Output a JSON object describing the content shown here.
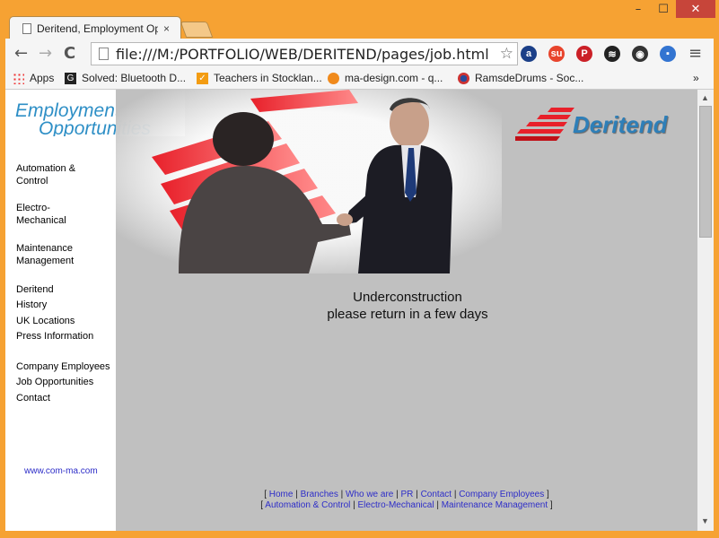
{
  "tab": {
    "title": "Deritend, Employment Op",
    "close": "×"
  },
  "window": {
    "minimize": "–",
    "maximize": "☐",
    "close": "✕"
  },
  "toolbar": {
    "back": "←",
    "forward": "→",
    "reload": "C",
    "url": "file:///M:/PORTFOLIO/WEB/DERITEND/pages/job.html",
    "star": "☆",
    "menu": "≡"
  },
  "extensions": [
    {
      "name": "amazon-icon",
      "label": "a",
      "color": "#1b3f88"
    },
    {
      "name": "stumbleupon-icon",
      "label": "su",
      "color": "#e8442c"
    },
    {
      "name": "pinterest-icon",
      "label": "P",
      "color": "#cb2027"
    },
    {
      "name": "layers-icon",
      "label": "≋",
      "color": "#222222"
    },
    {
      "name": "color-picker-icon",
      "label": "◉",
      "color": "#333333"
    },
    {
      "name": "delicious-icon",
      "label": "▪",
      "color": "#3274d1"
    }
  ],
  "bookmarks": [
    {
      "label": "Apps",
      "icon": "apps-icon"
    },
    {
      "label": "Solved: Bluetooth D...",
      "icon": "g-icon"
    },
    {
      "label": "Teachers in Stocklan...",
      "icon": "check-icon"
    },
    {
      "label": "ma-design.com - q...",
      "icon": "peach-icon"
    },
    {
      "label": "RamsdeDrums - Soc...",
      "icon": "drums-icon"
    }
  ],
  "bookmarks_more": "»",
  "header": {
    "line1": "Employment",
    "line2": "Opportunities",
    "logo": "Deritend"
  },
  "menu": [
    {
      "label": "Automation &",
      "top": 0
    },
    {
      "label": "Control",
      "top": 0
    },
    {
      "label": "Electro-",
      "top": 0
    },
    {
      "label": "Mechanical",
      "top": 0
    },
    {
      "label": "Maintenance",
      "top": 0
    },
    {
      "label": "Management",
      "top": 0
    },
    {
      "label": "Deritend",
      "top": 0
    },
    {
      "label": "History",
      "top": 0
    },
    {
      "label": "UK Locations",
      "top": 0
    },
    {
      "label": "Press Information",
      "top": 0
    },
    {
      "label": "Company Employees",
      "top": 0
    },
    {
      "label": "Job Opportunities",
      "top": 0
    },
    {
      "label": "Contact",
      "top": 0
    }
  ],
  "weblink": "www.com-ma.com",
  "message": {
    "line1": "Underconstruction",
    "line2": "please return in a few days"
  },
  "footer1": [
    "Home",
    "Branches",
    "Who we are",
    "PR",
    "Contact",
    "Company Employees"
  ],
  "footer2": [
    "Automation & Control",
    "Electro-Mechanical",
    "Maintenance Management"
  ]
}
